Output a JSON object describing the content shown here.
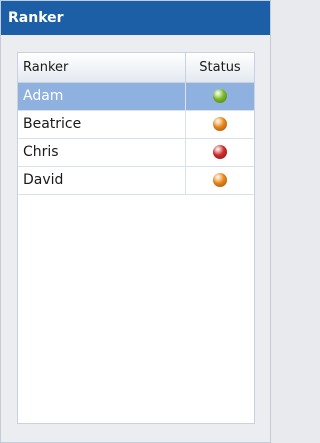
{
  "window": {
    "title": "Ranker"
  },
  "grid": {
    "columns": {
      "name": "Ranker",
      "status": "Status"
    },
    "rows": [
      {
        "name": "Adam",
        "status": "green",
        "color": "#7fbf2a",
        "selected": true
      },
      {
        "name": "Beatrice",
        "status": "orange",
        "color": "#f08a1c",
        "selected": false
      },
      {
        "name": "Chris",
        "status": "red",
        "color": "#d42d2d",
        "selected": false
      },
      {
        "name": "David",
        "status": "orange",
        "color": "#f08a1c",
        "selected": false
      }
    ]
  }
}
